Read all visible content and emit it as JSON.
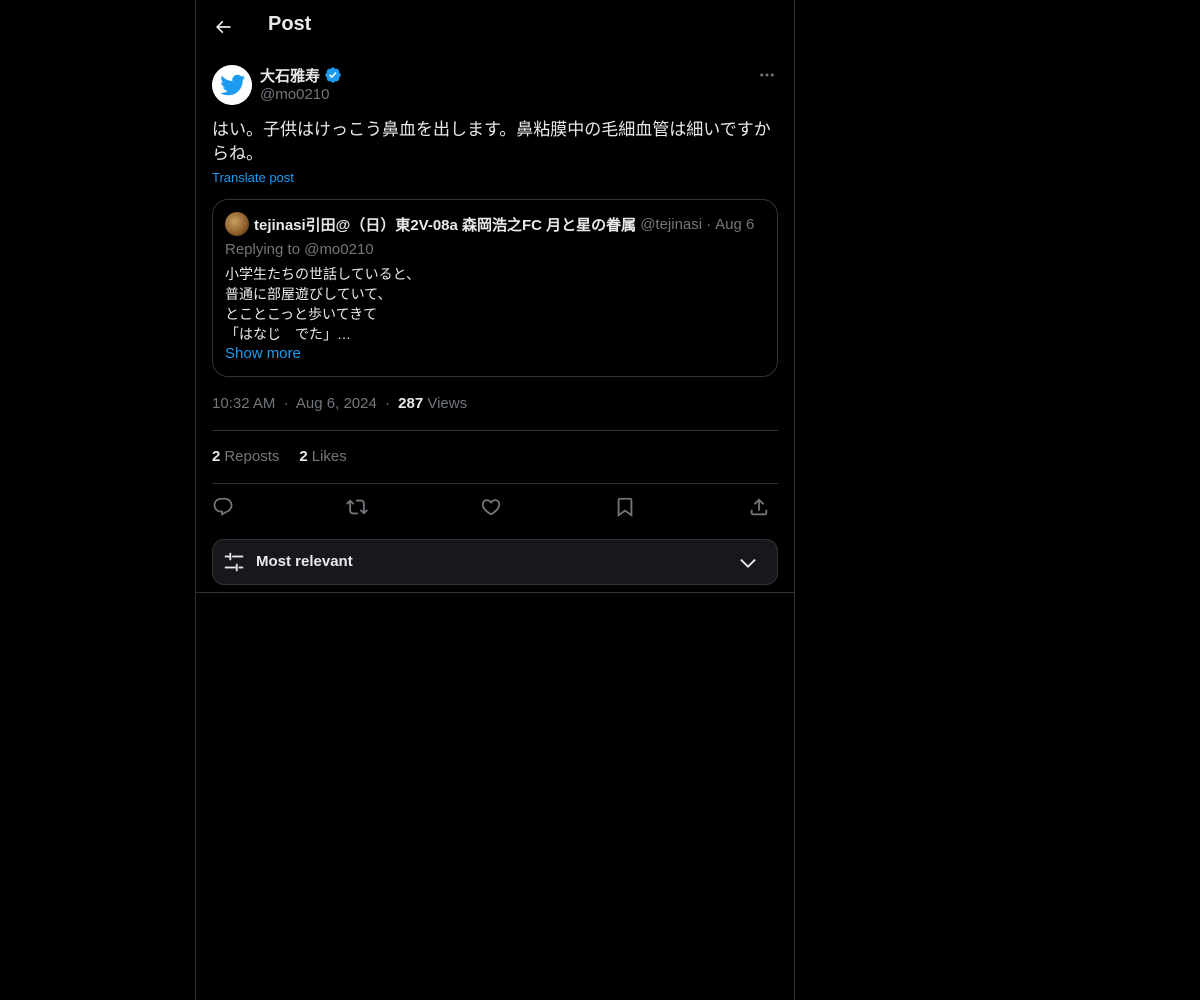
{
  "header": {
    "title": "Post",
    "back_icon": "arrow-left-icon"
  },
  "author": {
    "display_name": "大石雅寿",
    "handle": "@mo0210",
    "verified": true,
    "avatar_icon": "twitter-bird-icon"
  },
  "post": {
    "text": "はい。子供はけっこう鼻血を出します。鼻粘膜中の毛細血管は細いですからね。",
    "translate_label": "Translate post"
  },
  "quote": {
    "display_name": "tejinasi引田@（日）東2V-08a 森岡浩之FC 月と星の眷属",
    "handle": "@tejinasi",
    "separator": "·",
    "date": "Aug 6",
    "replying_to": "Replying to @mo0210",
    "lines": [
      "小学生たちの世話していると、",
      "普通に部屋遊びしていて、",
      "とことこっと歩いてきて",
      "「はなじ　でた」…"
    ],
    "show_more": "Show more"
  },
  "meta": {
    "time": "10:32 AM",
    "separator": "·",
    "date": "Aug 6, 2024",
    "views_count": "287",
    "views_label": "Views"
  },
  "stats": {
    "reposts_count": "2",
    "reposts_label": "Reposts",
    "likes_count": "2",
    "likes_label": "Likes"
  },
  "actions": [
    "reply-icon",
    "repost-icon",
    "like-icon",
    "bookmark-icon",
    "share-icon"
  ],
  "sort": {
    "label": "Most relevant"
  },
  "colors": {
    "background": "#000000",
    "text": "#e7e9ea",
    "secondary": "#71767b",
    "accent": "#1d9bf0",
    "border": "#2f3336"
  }
}
